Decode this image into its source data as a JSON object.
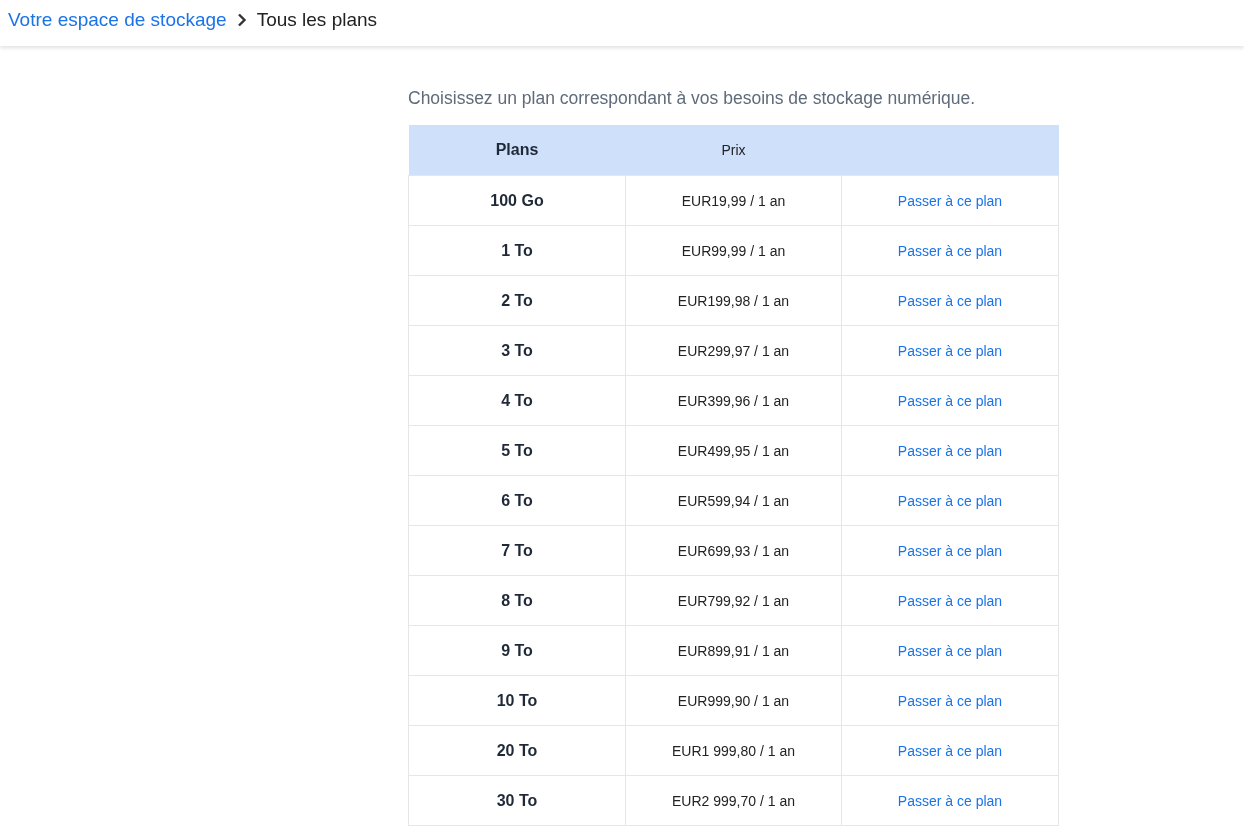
{
  "breadcrumb": {
    "parent": "Votre espace de stockage",
    "current": "Tous les plans"
  },
  "intro": "Choisissez un plan correspondant à vos besoins de stockage numérique.",
  "table": {
    "columns": [
      "Plans",
      "Prix"
    ],
    "rows": [
      {
        "plan": "100 Go",
        "price": "EUR19,99 / 1 an",
        "action": "Passer à ce plan"
      },
      {
        "plan": "1 To",
        "price": "EUR99,99 / 1 an",
        "action": "Passer à ce plan"
      },
      {
        "plan": "2 To",
        "price": "EUR199,98 / 1 an",
        "action": "Passer à ce plan"
      },
      {
        "plan": "3 To",
        "price": "EUR299,97 / 1 an",
        "action": "Passer à ce plan"
      },
      {
        "plan": "4 To",
        "price": "EUR399,96 / 1 an",
        "action": "Passer à ce plan"
      },
      {
        "plan": "5 To",
        "price": "EUR499,95 / 1 an",
        "action": "Passer à ce plan"
      },
      {
        "plan": "6 To",
        "price": "EUR599,94 / 1 an",
        "action": "Passer à ce plan"
      },
      {
        "plan": "7 To",
        "price": "EUR699,93 / 1 an",
        "action": "Passer à ce plan"
      },
      {
        "plan": "8 To",
        "price": "EUR799,92 / 1 an",
        "action": "Passer à ce plan"
      },
      {
        "plan": "9 To",
        "price": "EUR899,91 / 1 an",
        "action": "Passer à ce plan"
      },
      {
        "plan": "10 To",
        "price": "EUR999,90 / 1 an",
        "action": "Passer à ce plan"
      },
      {
        "plan": "20 To",
        "price": "EUR1 999,80 / 1 an",
        "action": "Passer à ce plan"
      },
      {
        "plan": "30 To",
        "price": "EUR2 999,70 / 1 an",
        "action": "Passer à ce plan"
      }
    ]
  }
}
